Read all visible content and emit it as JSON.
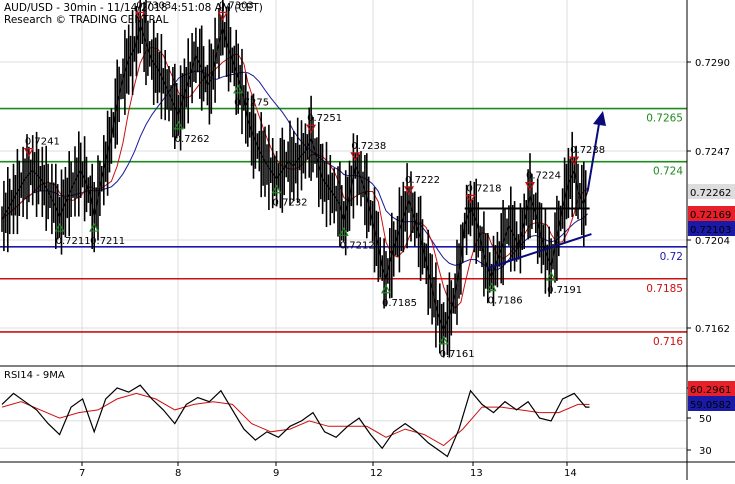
{
  "header": {
    "line1": "AUD/USD - 30min - 11/14/2018 4:51:08 AM (CET)",
    "line2": "Research © TRADING CENTRAL"
  },
  "colors": {
    "price": "#000000",
    "ma_fast": "#cc1010",
    "ma_slow": "#1a1a9c",
    "support": "#cc1010",
    "resistance": "#1f8a1f",
    "pivot": "#1a1ab0",
    "forecast": "#0a0a7a",
    "current_price_bg": "#dddddd",
    "red_badge": "#e8202a",
    "blue_badge": "#1a1aa8",
    "rsi_line": "#000000",
    "rsi_ma": "#cc1010",
    "grid": "#dcdcdc"
  },
  "chart_data": [
    {
      "type": "line",
      "title": "AUD/USD - 30min - 11/14/2018 4:51:08 AM (CET)",
      "x_labels": [
        "7",
        "8",
        "9",
        "12",
        "13",
        "14"
      ],
      "ylim": [
        0.7144,
        0.7316
      ],
      "y_ticks": [
        "0.7290",
        "0.7247",
        "0.7204",
        "0.7162"
      ],
      "price_path": [
        [
          0,
          0.7213
        ],
        [
          4,
          0.7219
        ],
        [
          8,
          0.7226
        ],
        [
          12,
          0.7232
        ],
        [
          16,
          0.7236
        ],
        [
          20,
          0.7232
        ],
        [
          24,
          0.7226
        ],
        [
          28,
          0.7219
        ],
        [
          30,
          0.7214
        ],
        [
          33,
          0.7221
        ],
        [
          37,
          0.7229
        ],
        [
          41,
          0.7236
        ],
        [
          43,
          0.7232
        ],
        [
          46,
          0.7224
        ],
        [
          48,
          0.7214
        ],
        [
          52,
          0.7232
        ],
        [
          57,
          0.7252
        ],
        [
          60,
          0.7268
        ],
        [
          63,
          0.7279
        ],
        [
          66,
          0.7288
        ],
        [
          69,
          0.7293
        ],
        [
          72,
          0.7304
        ],
        [
          75,
          0.7296
        ],
        [
          78,
          0.7288
        ],
        [
          81,
          0.7284
        ],
        [
          84,
          0.7278
        ],
        [
          87,
          0.7272
        ],
        [
          90,
          0.7266
        ],
        [
          92,
          0.7262
        ],
        [
          95,
          0.7272
        ],
        [
          98,
          0.7281
        ],
        [
          101,
          0.729
        ],
        [
          104,
          0.7284
        ],
        [
          107,
          0.7276
        ],
        [
          109,
          0.7279
        ],
        [
          112,
          0.7292
        ],
        [
          115,
          0.7303
        ],
        [
          118,
          0.7293
        ],
        [
          121,
          0.7285
        ],
        [
          123,
          0.7279
        ],
        [
          126,
          0.727
        ],
        [
          128,
          0.726
        ],
        [
          131,
          0.7252
        ],
        [
          134,
          0.7245
        ],
        [
          137,
          0.724
        ],
        [
          140,
          0.7236
        ],
        [
          143,
          0.7232
        ],
        [
          146,
          0.7236
        ],
        [
          149,
          0.724
        ],
        [
          152,
          0.7238
        ],
        [
          155,
          0.7242
        ],
        [
          158,
          0.7245
        ],
        [
          161,
          0.7251
        ],
        [
          164,
          0.7242
        ],
        [
          167,
          0.7232
        ],
        [
          170,
          0.7228
        ],
        [
          173,
          0.7224
        ],
        [
          176,
          0.722
        ],
        [
          178,
          0.7212
        ],
        [
          181,
          0.7224
        ],
        [
          184,
          0.7238
        ],
        [
          187,
          0.7232
        ],
        [
          190,
          0.7224
        ],
        [
          193,
          0.7212
        ],
        [
          196,
          0.72
        ],
        [
          198,
          0.719
        ],
        [
          200,
          0.7185
        ],
        [
          203,
          0.7196
        ],
        [
          206,
          0.7205
        ],
        [
          209,
          0.7214
        ],
        [
          212,
          0.7222
        ],
        [
          215,
          0.7213
        ],
        [
          218,
          0.7204
        ],
        [
          221,
          0.7192
        ],
        [
          224,
          0.718
        ],
        [
          227,
          0.7169
        ],
        [
          230,
          0.7161
        ],
        [
          233,
          0.7168
        ],
        [
          236,
          0.7178
        ],
        [
          239,
          0.7194
        ],
        [
          241,
          0.721
        ],
        [
          244,
          0.7218
        ],
        [
          247,
          0.7212
        ],
        [
          250,
          0.72
        ],
        [
          253,
          0.719
        ],
        [
          255,
          0.7186
        ],
        [
          258,
          0.7194
        ],
        [
          261,
          0.7202
        ],
        [
          264,
          0.721
        ],
        [
          267,
          0.7205
        ],
        [
          269,
          0.72
        ],
        [
          272,
          0.7212
        ],
        [
          275,
          0.7224
        ],
        [
          278,
          0.7216
        ],
        [
          281,
          0.7204
        ],
        [
          284,
          0.7195
        ],
        [
          286,
          0.7191
        ],
        [
          289,
          0.7204
        ],
        [
          292,
          0.7218
        ],
        [
          295,
          0.723
        ],
        [
          298,
          0.7236
        ],
        [
          300,
          0.7226
        ],
        [
          303,
          0.722
        ],
        [
          305,
          0.7226
        ]
      ],
      "levels": [
        {
          "value": 0.7265,
          "label": "0.7265",
          "kind": "resistance"
        },
        {
          "value": 0.724,
          "label": "0.724",
          "kind": "resistance"
        },
        {
          "value": 0.72,
          "label": "0.72",
          "kind": "pivot"
        },
        {
          "value": 0.7185,
          "label": "0.7185",
          "kind": "support"
        },
        {
          "value": 0.716,
          "label": "0.716",
          "kind": "support"
        }
      ],
      "current_price": "0.72262",
      "price_badges": [
        "0.72169",
        "0.72103"
      ],
      "highs": [
        {
          "label": "0.7241",
          "x": 14,
          "v": 0.7241
        },
        {
          "label": "0.7303",
          "x": 72,
          "v": 0.7305
        },
        {
          "label": "0.7303",
          "x": 115,
          "v": 0.7305
        },
        {
          "label": "0.7251",
          "x": 161,
          "v": 0.7252
        },
        {
          "label": "0.7238",
          "x": 184,
          "v": 0.7239
        },
        {
          "label": "0.7222",
          "x": 212,
          "v": 0.7223
        },
        {
          "label": "0.7218",
          "x": 244,
          "v": 0.7219
        },
        {
          "label": "0.7224",
          "x": 275,
          "v": 0.7225
        },
        {
          "label": "0.7238",
          "x": 298,
          "v": 0.7237
        }
      ],
      "lows": [
        {
          "label": "0.7211",
          "x": 30,
          "v": 0.7214
        },
        {
          "label": "0.7211",
          "x": 48,
          "v": 0.7214
        },
        {
          "label": "0.7262",
          "x": 92,
          "v": 0.7262
        },
        {
          "label": "0.7275",
          "x": 123,
          "v": 0.7279
        },
        {
          "label": "0.7232",
          "x": 143,
          "v": 0.7232
        },
        {
          "label": "0.7212",
          "x": 178,
          "v": 0.7212
        },
        {
          "label": "0.7185",
          "x": 200,
          "v": 0.7185
        },
        {
          "label": "0.7161",
          "x": 230,
          "v": 0.7161
        },
        {
          "label": "0.7186",
          "x": 255,
          "v": 0.7186
        },
        {
          "label": "0.7191",
          "x": 286,
          "v": 0.7191
        }
      ]
    },
    {
      "type": "line",
      "title": "RSI14 - 9MA",
      "ylim": [
        20,
        90
      ],
      "y_ticks": [
        "70",
        "50",
        "30"
      ],
      "badges": [
        "60.2961",
        "59.0582"
      ],
      "rsi_path": [
        [
          0,
          62
        ],
        [
          6,
          70
        ],
        [
          12,
          64
        ],
        [
          18,
          58
        ],
        [
          24,
          48
        ],
        [
          30,
          40
        ],
        [
          36,
          60
        ],
        [
          42,
          66
        ],
        [
          48,
          42
        ],
        [
          54,
          66
        ],
        [
          60,
          74
        ],
        [
          66,
          71
        ],
        [
          72,
          76
        ],
        [
          78,
          66
        ],
        [
          84,
          58
        ],
        [
          90,
          48
        ],
        [
          96,
          62
        ],
        [
          102,
          67
        ],
        [
          108,
          64
        ],
        [
          114,
          72
        ],
        [
          120,
          58
        ],
        [
          126,
          44
        ],
        [
          132,
          36
        ],
        [
          138,
          42
        ],
        [
          144,
          38
        ],
        [
          150,
          46
        ],
        [
          156,
          50
        ],
        [
          162,
          56
        ],
        [
          168,
          42
        ],
        [
          174,
          38
        ],
        [
          180,
          46
        ],
        [
          186,
          52
        ],
        [
          192,
          40
        ],
        [
          198,
          30
        ],
        [
          204,
          42
        ],
        [
          210,
          48
        ],
        [
          216,
          42
        ],
        [
          222,
          34
        ],
        [
          228,
          28
        ],
        [
          232,
          24
        ],
        [
          238,
          44
        ],
        [
          244,
          72
        ],
        [
          250,
          62
        ],
        [
          256,
          56
        ],
        [
          262,
          64
        ],
        [
          268,
          58
        ],
        [
          274,
          64
        ],
        [
          280,
          52
        ],
        [
          286,
          50
        ],
        [
          292,
          66
        ],
        [
          298,
          70
        ],
        [
          304,
          60
        ],
        [
          306,
          60
        ]
      ],
      "rsi_ma_path": [
        [
          0,
          60
        ],
        [
          10,
          64
        ],
        [
          20,
          58
        ],
        [
          30,
          52
        ],
        [
          40,
          56
        ],
        [
          50,
          58
        ],
        [
          60,
          66
        ],
        [
          70,
          70
        ],
        [
          80,
          66
        ],
        [
          90,
          58
        ],
        [
          100,
          62
        ],
        [
          110,
          64
        ],
        [
          120,
          62
        ],
        [
          130,
          48
        ],
        [
          140,
          42
        ],
        [
          150,
          44
        ],
        [
          160,
          50
        ],
        [
          170,
          46
        ],
        [
          180,
          46
        ],
        [
          190,
          46
        ],
        [
          200,
          38
        ],
        [
          210,
          44
        ],
        [
          220,
          40
        ],
        [
          230,
          32
        ],
        [
          240,
          44
        ],
        [
          250,
          60
        ],
        [
          260,
          60
        ],
        [
          270,
          58
        ],
        [
          280,
          56
        ],
        [
          290,
          56
        ],
        [
          300,
          62
        ],
        [
          306,
          62
        ]
      ]
    }
  ]
}
